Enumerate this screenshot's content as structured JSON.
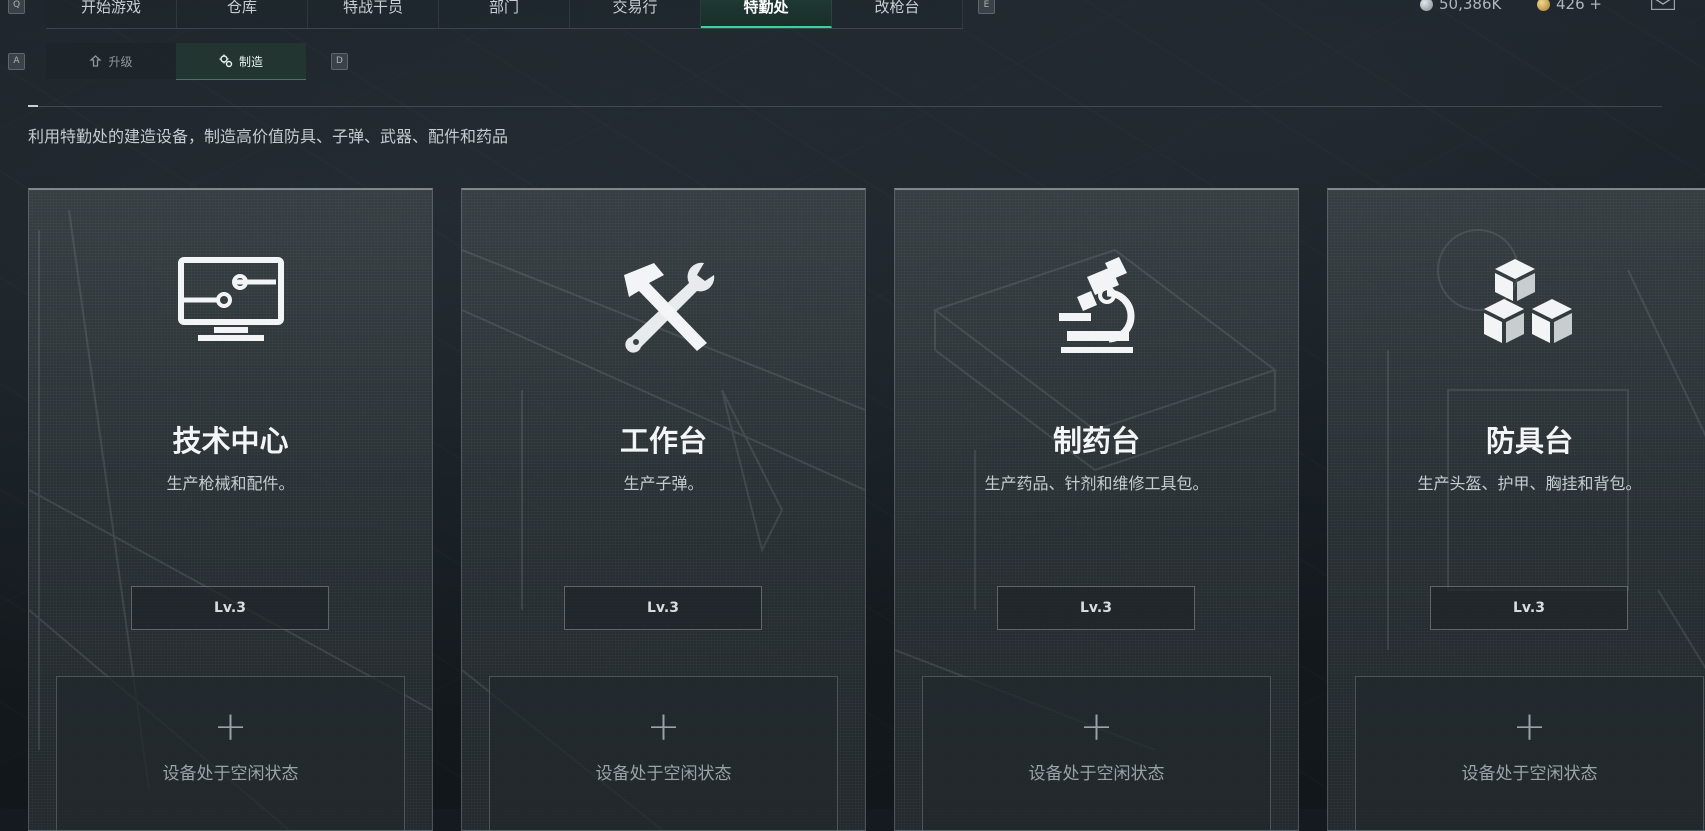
{
  "nav": {
    "key_left": "Q",
    "key_right": "E",
    "tabs": [
      {
        "label": "开始游戏"
      },
      {
        "label": "仓库"
      },
      {
        "label": "特战干员"
      },
      {
        "label": "部门"
      },
      {
        "label": "交易行"
      },
      {
        "label": "特勤处",
        "active": true
      },
      {
        "label": "改枪台"
      }
    ],
    "currency": [
      {
        "icon": "silver-coin-icon",
        "value": "50,386K"
      },
      {
        "icon": "gold-coin-icon",
        "value": "426 +"
      }
    ],
    "mail_icon": "mail-icon"
  },
  "subnav": {
    "key_left": "A",
    "key_right": "D",
    "tabs": [
      {
        "label": "升级",
        "icon": "upgrade-icon"
      },
      {
        "label": "制造",
        "icon": "craft-icon",
        "active": true
      }
    ]
  },
  "description": "利用特勤处的建造设备，制造高价值防具、子弹、武器、配件和药品",
  "stations": [
    {
      "title": "技术中心",
      "subtitle": "生产枪械和配件。",
      "level": "Lv.3",
      "plus": "+",
      "status": "设备处于空闲状态",
      "icon": "computer-monitor-icon"
    },
    {
      "title": "工作台",
      "subtitle": "生产子弹。",
      "level": "Lv.3",
      "plus": "+",
      "status": "设备处于空闲状态",
      "icon": "hammer-wrench-icon"
    },
    {
      "title": "制药台",
      "subtitle": "生产药品、针剂和维修工具包。",
      "level": "Lv.3",
      "plus": "+",
      "status": "设备处于空闲状态",
      "icon": "microscope-icon"
    },
    {
      "title": "防具台",
      "subtitle": "生产头盔、护甲、胸挂和背包。",
      "level": "Lv.3",
      "plus": "+",
      "status": "设备处于空闲状态",
      "icon": "cubes-icon"
    }
  ],
  "colors": {
    "accent_green": "#3ecf9a",
    "active_tab_bg": "#1f3a34"
  }
}
